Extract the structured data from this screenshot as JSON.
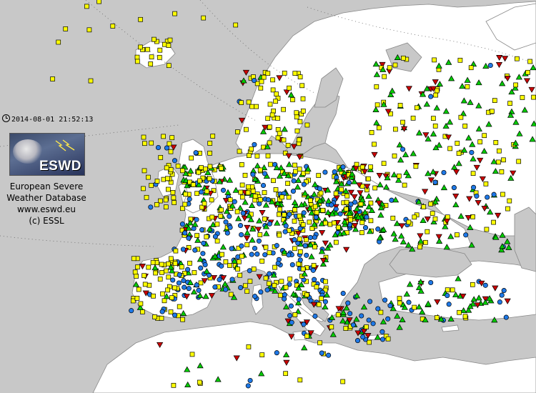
{
  "timestamp": "2014-08-01 21:52:13",
  "logo": {
    "text": "ESWD"
  },
  "info": {
    "line1": "European Severe",
    "line2": "Weather Database",
    "line3": "www.eswd.eu",
    "line4": "(c) ESSL"
  },
  "colors": {
    "sea": "#c8c8c8",
    "land": "#ffffff",
    "border": "#888888",
    "report_yellow": "#ffff00",
    "report_green": "#00cc00",
    "report_red": "#cc0000",
    "report_blue": "#1e78e6"
  },
  "icons": {
    "clock": "clock-icon",
    "square_marker": "yellow-square-marker",
    "up_triangle_marker": "green-triangle-marker",
    "down_triangle_marker": "red-down-triangle-marker",
    "circle_marker": "blue-circle-marker"
  }
}
